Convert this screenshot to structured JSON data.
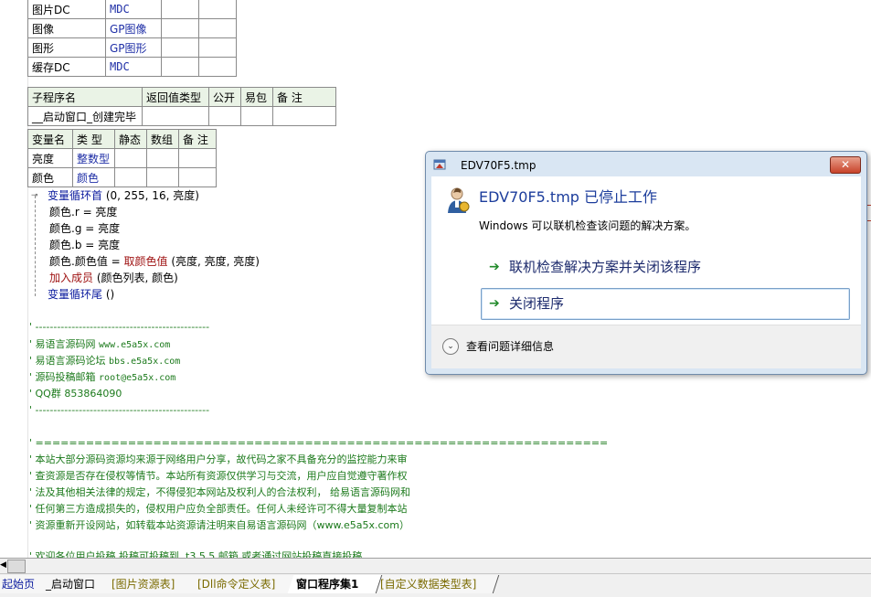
{
  "resource_table": {
    "rows": [
      {
        "name": "图片DC",
        "type": "MDC"
      },
      {
        "name": "图像",
        "type": "GP图像"
      },
      {
        "name": "图形",
        "type": "GP图形"
      },
      {
        "name": "缓存DC",
        "type": "MDC"
      }
    ]
  },
  "sub_table": {
    "headers": [
      "子程序名",
      "返回值类型",
      "公开",
      "易包",
      "备 注"
    ],
    "row": {
      "name": "__启动窗口_创建完毕"
    }
  },
  "var_table": {
    "headers": [
      "变量名",
      "类 型",
      "静态",
      "数组",
      "备 注"
    ],
    "rows": [
      {
        "name": "亮度",
        "type": "整数型"
      },
      {
        "name": "颜色",
        "type": "颜色"
      }
    ]
  },
  "code": {
    "loop_start": {
      "kw": "变量循环首",
      "args": " (0, 255, 16, 亮度)"
    },
    "line1": "颜色.r = 亮度",
    "line2": "颜色.g = 亮度",
    "line3": "颜色.b = 亮度",
    "line4_a": "颜色.颜色值 = ",
    "line4_fn": "取颜色值",
    "line4_b": " (亮度, 亮度, 亮度)",
    "line5_fn": "加入成员",
    "line5_b": " (颜色列表, 颜色)",
    "loop_end": {
      "kw": "变量循环尾",
      "args": " ()"
    }
  },
  "comments": {
    "sep1": "' ------------------------------------------------",
    "c1_a": "' 易语言源码网     ",
    "c1_b": "www.e5a5x.com",
    "c2_a": "' 易语言源码论坛     ",
    "c2_b": "bbs.e5a5x.com",
    "c3_a": "' 源码投稿邮箱  ",
    "c3_b": "root@e5a5x.com",
    "c4": "' QQ群     853864090",
    "sep2": "' ------------------------------------------------",
    "sep3": "' ====================================================================",
    "p1": "' 本站大部分源码资源均来源于网络用户分享，故代码之家不具备充分的监控能力来审",
    "p2": "' 查资源是否存在侵权等情节。本站所有资源仅供学习与交流，用户应自觉遵守著作权",
    "p3": "' 法及其他相关法律的规定，不得侵犯本网站及权利人的合法权利， 给易语言源码网和",
    "p4": "' 任何第三方造成损失的，侵权用户应负全部责任。任何人未经许可不得大量复制本站",
    "p5": "' 资源重新开设网站，如转载本站资源请注明来自易语言源码网（www.e5a5x.com）",
    "p6": "' 欢迎各位用户投稿 投稿可投稿到      .t3.5.5        邮箱 或者通过网站投稿直接投稿"
  },
  "tabs": [
    {
      "label": "起始页"
    },
    {
      "label": "_启动窗口"
    },
    {
      "label": "[图片资源表]"
    },
    {
      "label": "[Dll命令定义表]"
    },
    {
      "label": "窗口程序集1"
    },
    {
      "label": "[自定义数据类型表]"
    }
  ],
  "dialog": {
    "title": "EDV70F5.tmp",
    "close_label": "✕",
    "heading": "EDV70F5.tmp 已停止工作",
    "description": "Windows 可以联机检查该问题的解决方案。",
    "option1": "联机检查解决方案并关闭该程序",
    "option2": "关闭程序",
    "details": "查看问题详细信息",
    "arrow_glyph": "➔",
    "details_glyph": "⌄"
  },
  "colors": {
    "keyword": "#0a1a9e",
    "function": "#9e1010",
    "comment": "#1c7a1c",
    "dialog_heading": "#1c3d9c",
    "table_header": "#eaf3e6"
  }
}
